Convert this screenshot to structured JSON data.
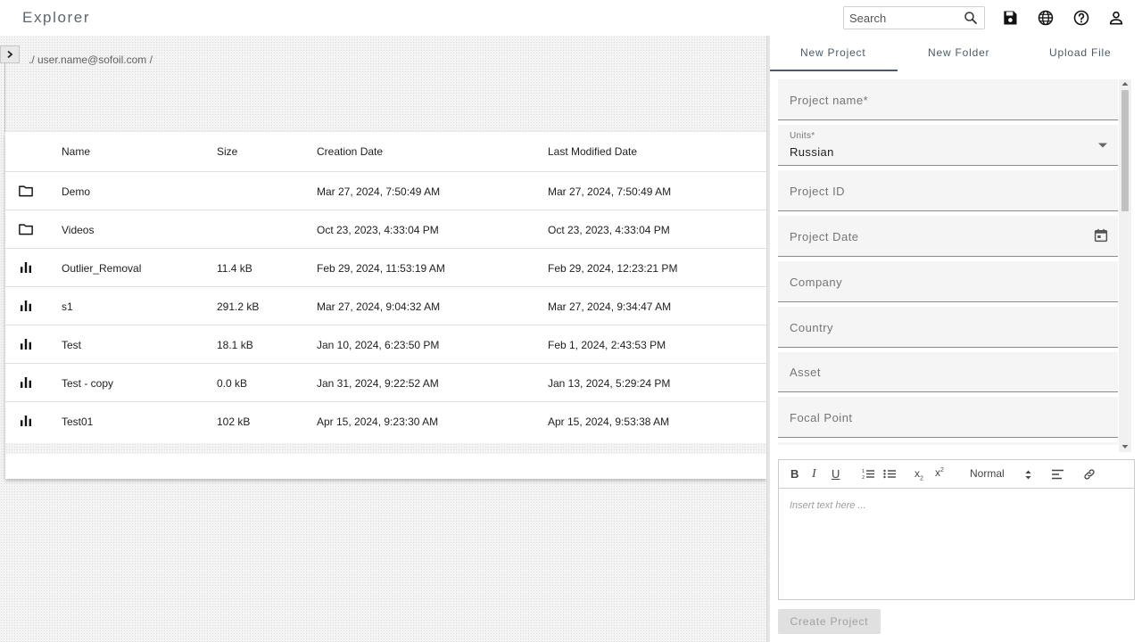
{
  "app": {
    "title": "Explorer"
  },
  "search": {
    "placeholder": "Search"
  },
  "top_icons": [
    "save-icon",
    "globe-icon",
    "help-icon",
    "account-icon"
  ],
  "breadcrumb": "./ user.name@sofoil.com /",
  "table": {
    "columns": [
      "Name",
      "Size",
      "Creation Date",
      "Last Modified Date"
    ],
    "rows": [
      {
        "icon": "folder-icon",
        "name": "Demo",
        "size": "",
        "created": "Mar 27, 2024, 7:50:49 AM",
        "modified": "Mar 27, 2024, 7:50:49 AM"
      },
      {
        "icon": "folder-icon",
        "name": "Videos",
        "size": "",
        "created": "Oct 23, 2023, 4:33:04 PM",
        "modified": "Oct 23, 2023, 4:33:04 PM"
      },
      {
        "icon": "chart-icon",
        "name": "Outlier_Removal",
        "size": "11.4 kB",
        "created": "Feb 29, 2024, 11:53:19 AM",
        "modified": "Feb 29, 2024, 12:23:21 PM"
      },
      {
        "icon": "chart-icon",
        "name": "s1",
        "size": "291.2 kB",
        "created": "Mar 27, 2024, 9:04:32 AM",
        "modified": "Mar 27, 2024, 9:34:47 AM"
      },
      {
        "icon": "chart-icon",
        "name": "Test",
        "size": "18.1 kB",
        "created": "Jan 10, 2024, 6:23:50 PM",
        "modified": "Feb 1, 2024, 2:43:53 PM"
      },
      {
        "icon": "chart-icon",
        "name": "Test - copy",
        "size": "0.0 kB",
        "created": "Jan 31, 2024, 9:22:52 AM",
        "modified": "Jan 13, 2024, 5:29:24 PM"
      },
      {
        "icon": "chart-icon",
        "name": "Test01",
        "size": "102 kB",
        "created": "Apr 15, 2024, 9:23:30 AM",
        "modified": "Apr 15, 2024, 9:53:38 AM"
      }
    ]
  },
  "tabs": [
    "New Project",
    "New Folder",
    "Upload File"
  ],
  "form": {
    "project_name": "Project name*",
    "units_label": "Units*",
    "units_value": "Russian",
    "project_id": "Project ID",
    "project_date": "Project Date",
    "company": "Company",
    "country": "Country",
    "asset": "Asset",
    "focal_point": "Focal Point"
  },
  "editor": {
    "format_value": "Normal",
    "placeholder": "Insert text here ..."
  },
  "create_button": "Create Project",
  "colors": {
    "accent": "#4a5a68",
    "title": "#5b6670"
  }
}
